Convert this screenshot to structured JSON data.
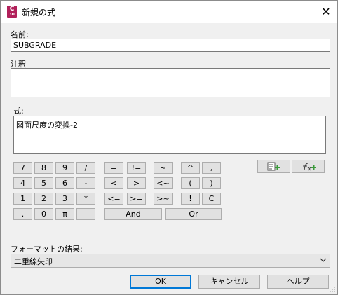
{
  "window": {
    "title": "新規の式",
    "close_glyph": "✕",
    "app_icon_letter": "C",
    "app_icon_sub": "3D"
  },
  "name_label": "名前:",
  "name_value": "SUBGRADE",
  "note_label": "注釈",
  "note_value": "",
  "expr_label": "式:",
  "expr_value": "図面尺度の変換-2",
  "keypad": {
    "digits": [
      "7",
      "8",
      "9",
      "/",
      "4",
      "5",
      "6",
      "-",
      "1",
      "2",
      "3",
      "*",
      ".",
      "0",
      "π",
      "+"
    ],
    "ops": [
      "=",
      "!=",
      "~",
      "^",
      ",",
      "<",
      ">",
      "<~",
      "(",
      ")",
      "<=",
      ">=",
      ">~",
      "!",
      "C"
    ],
    "and": "And",
    "or": "Or"
  },
  "icons": {
    "insert_property": "insert-property-icon",
    "insert_function": "insert-function-icon",
    "accent": "#3a9a3a"
  },
  "format_label": "フォーマットの結果:",
  "format_value": "二重線矢印",
  "buttons": {
    "ok": "OK",
    "cancel": "キャンセル",
    "help": "ヘルプ"
  },
  "colors": {
    "app_icon": "#b1205a",
    "default_border": "#0078d7"
  }
}
